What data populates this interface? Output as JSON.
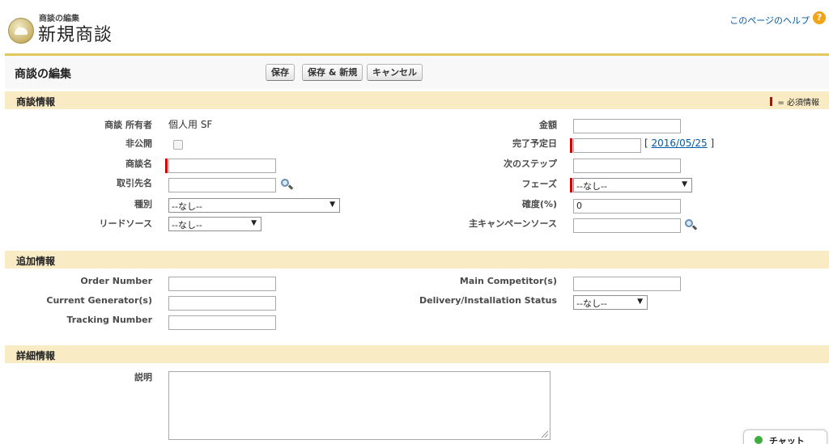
{
  "header": {
    "subtitle": "商談の編集",
    "title": "新規商談",
    "help_link": "このページのヘルプ",
    "help_icon": "?"
  },
  "edit_block": {
    "title": "商談の編集",
    "buttons": {
      "save": "保存",
      "save_new": "保存 & 新規",
      "cancel": "キャンセル"
    }
  },
  "sections": {
    "opportunity_info": {
      "title": "商談情報",
      "required_note": "= 必須情報",
      "left": {
        "owner": {
          "label": "商談 所有者",
          "value": "個人用 SF"
        },
        "private": {
          "label": "非公開"
        },
        "name": {
          "label": "商談名",
          "value": ""
        },
        "account": {
          "label": "取引先名",
          "value": ""
        },
        "type": {
          "label": "種別",
          "selected": "--なし--"
        },
        "lead_source": {
          "label": "リードソース",
          "selected": "--なし--"
        }
      },
      "right": {
        "amount": {
          "label": "金額",
          "value": ""
        },
        "close_date": {
          "label": "完了予定日",
          "value": "",
          "today_prefix": "[",
          "today": "2016/05/25",
          "today_suffix": "]"
        },
        "next_step": {
          "label": "次のステップ",
          "value": ""
        },
        "stage": {
          "label": "フェーズ",
          "selected": "--なし--"
        },
        "probability": {
          "label": "確度(%)",
          "value": "0"
        },
        "campaign": {
          "label": "主キャンペーンソース",
          "value": ""
        }
      }
    },
    "additional_info": {
      "title": "追加情報",
      "left": {
        "order_number": {
          "label": "Order Number",
          "value": ""
        },
        "current_generators": {
          "label": "Current Generator(s)",
          "value": ""
        },
        "tracking_number": {
          "label": "Tracking Number",
          "value": ""
        }
      },
      "right": {
        "main_competitors": {
          "label": "Main Competitor(s)",
          "value": ""
        },
        "delivery_status": {
          "label": "Delivery/Installation Status",
          "selected": "--なし--"
        }
      }
    },
    "detail_info": {
      "title": "詳細情報",
      "description": {
        "label": "説明",
        "value": ""
      }
    }
  },
  "chat": {
    "label": "チャット"
  },
  "colors": {
    "required": "#cc0000",
    "section_bar": "#f9ebc4",
    "accent_border": "#e3c862",
    "link": "#015ba7"
  }
}
